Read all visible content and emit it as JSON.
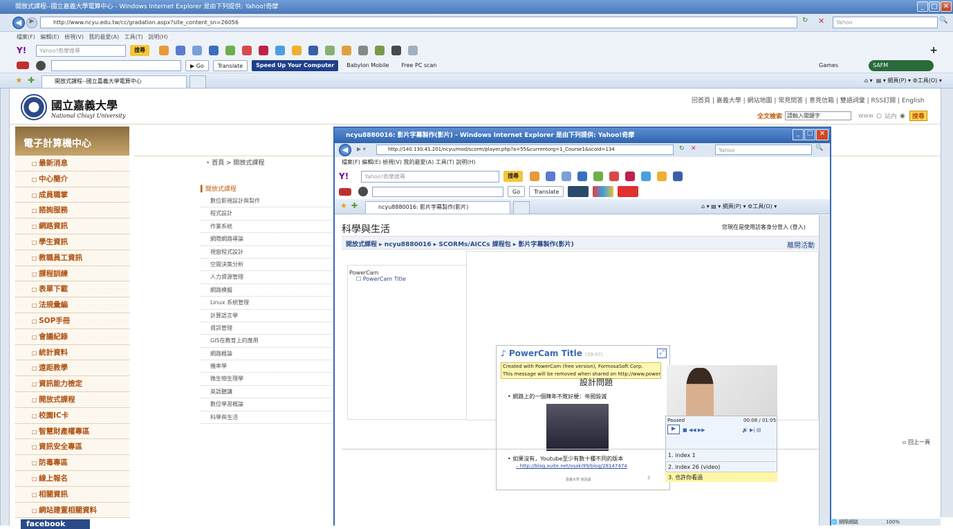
{
  "ie": {
    "title": "開放式課程--國立嘉義大學電算中心 - Windows Internet Explorer 是由下列提供: Yahoo!奇摩",
    "address": "http://www.ncyu.edu.tw/cc/gradation.aspx?site_content_sn=26056",
    "search_placeholder": "Yahoo",
    "menu": "檔案(F) 編輯(E) 檢視(V) 我的最愛(A) 工具(T) 說明(H)",
    "yahoo_search_placeholder": "Yahoo!奇摩搜尋",
    "search_btn": "搜尋",
    "go": "Go",
    "translate": "Translate",
    "speed_up": "Speed Up Your Computer",
    "babylon": "Babylon Mobile",
    "free_pc": "Free PC scan",
    "games": "Games",
    "safm": "SAFM",
    "tab_title": "開放式課程--國立嘉義大學電算中心",
    "page_menu": "網頁(P)",
    "tools_menu": "工具(O)",
    "status_zone": "網際網路",
    "zoom": "100%"
  },
  "site": {
    "logo_cn": "國立嘉義大學",
    "logo_en": "National Chiayi University",
    "top_links": "回首頁 | 嘉義大學 | 網站地圖 | 常見問答 | 意見信箱 | 雙語詞彙 | RSS訂閱 | English",
    "fulltext_label": "全文檢索",
    "fulltext_placeholder": "請輸入關鍵字",
    "opt_www": "www",
    "opt_site": "站內",
    "search_btn": "搜尋",
    "center_title": "電子計算機中心",
    "breadcrumb": "首頁 > 開放式課程",
    "back_top": "回上一頁",
    "facebook": "facebook",
    "sidebar": [
      "最新消息",
      "中心簡介",
      "成員職掌",
      "諮詢服務",
      "網路資訊",
      "學生資訊",
      "教職員工資訊",
      "課程訓練",
      "表單下載",
      "法規彙編",
      "SOP手冊",
      "會議紀錄",
      "統計資料",
      "遠距教學",
      "資訊能力檢定",
      "開放式課程",
      "校園IC卡",
      "智慧財產權專區",
      "資訊安全專區",
      "防毒專區",
      "線上報名",
      "相關資訊",
      "網站建置相關資料"
    ],
    "course_heading": "開放式課程",
    "courses": [
      "數位影視設計與製作",
      "程式設計",
      "作業系統",
      "網際網路導論",
      "視窗程式設計",
      "空間決策分析",
      "人力資源管理",
      "網路模擬",
      "Linux 系統管理",
      "計算語言學",
      "資訊管理",
      "GIS在教育上的應用",
      "網路概論",
      "機率學",
      "微生物生理學",
      "英語聽講",
      "數位學習概論",
      "科學與生活"
    ]
  },
  "popup": {
    "title": "ncyu8880016: 影片字幕製作(影片) - Windows Internet Explorer 是由下列提供: Yahoo!奇摩",
    "address": "http://140.130.41.201/ncyu/mod/scorm/player.php?a=55&currentorg=1_Course1&scoid=134",
    "search_placeholder": "Yahoo",
    "menu": "檔案(F) 編輯(E) 檢視(V) 我的最愛(A) 工具(T) 說明(H)",
    "tab_title": "ncyu8880016: 影片字幕製作(影片)",
    "course_title": "科學與生活",
    "login_text": "您現在是使用訪客身分登入 (登入)",
    "breadcrumb": "開放式課程 ▸ ncyu8880016 ▸ SCORMs/AICCs 課程包 ▸ 影片字幕製作(影片)",
    "exit": "離開活動",
    "toc_title": "PowerCam",
    "toc_item": "PowerCam Title",
    "pc_title": "PowerCam Title",
    "pc_duration": "(39:07)",
    "notice_line1": "Created with PowerCam (free version), FormosaSoft Corp.",
    "notice_line2": "This message will be removed when shared on http://www.power",
    "slide_heading": "設計問題",
    "bullet1": "網路上的一個陳年不敗好梗：帝國毀滅",
    "bullet2": "如果沒有，Youtube至少有數十種不同的版本",
    "link": "http://blog.xuite.net/osaki99/blog/28147474",
    "slide_footer": "嘉義大學 資訊處",
    "slide_num": "3",
    "player_status": "Paused",
    "player_time": "00:08 / 01:05",
    "index": [
      "1. index 1",
      "2. index 26 (video)",
      "3. 也許你看過"
    ]
  }
}
